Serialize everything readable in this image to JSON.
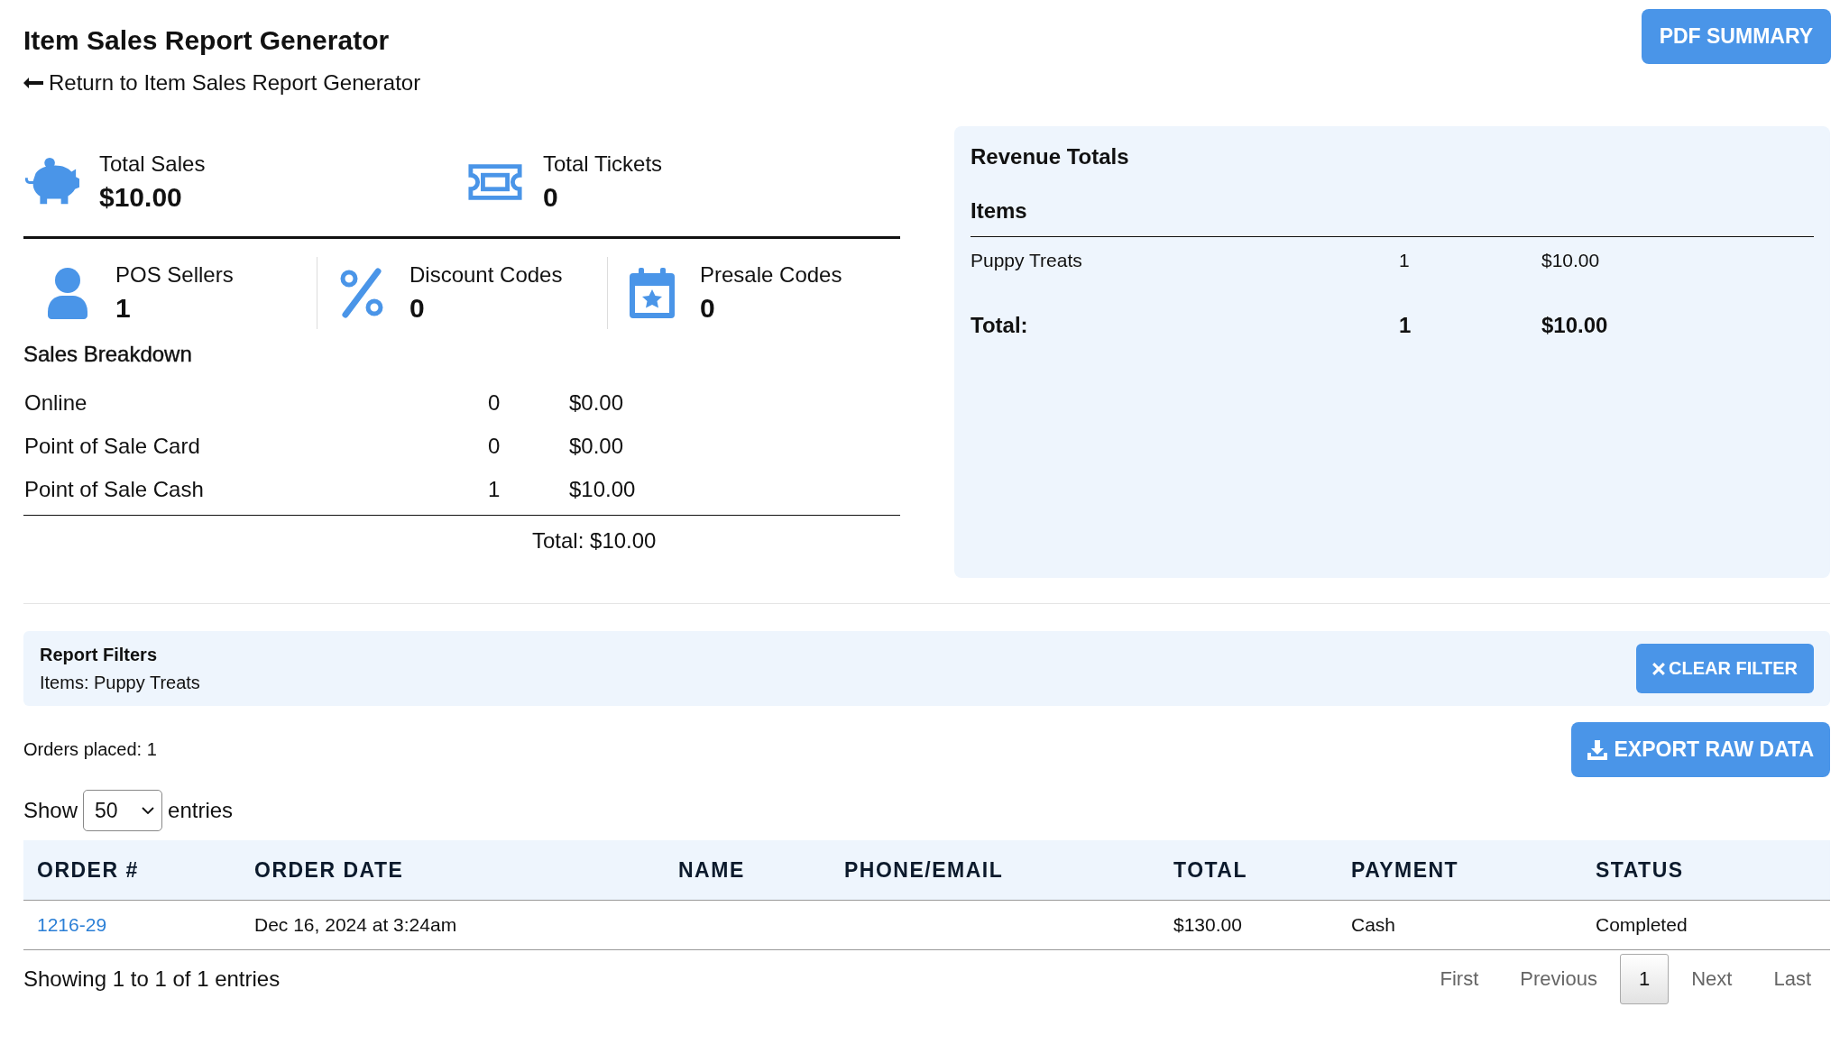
{
  "header": {
    "title": "Item Sales Report Generator",
    "back_link": "Return to Item Sales Report Generator",
    "pdf_button": "PDF SUMMARY"
  },
  "stats_top": [
    {
      "kind": "piggy",
      "label": "Total Sales",
      "value": "$10.00"
    },
    {
      "kind": "ticket",
      "label": "Total Tickets",
      "value": "0"
    }
  ],
  "stats_bottom": [
    {
      "kind": "person",
      "label": "POS Sellers",
      "value": "1"
    },
    {
      "kind": "percent",
      "label": "Discount Codes",
      "value": "0"
    },
    {
      "kind": "calendar",
      "label": "Presale Codes",
      "value": "0"
    }
  ],
  "sales_breakdown": {
    "title": "Sales Breakdown",
    "rows": [
      {
        "channel": "Online",
        "count": "0",
        "amount": "$0.00"
      },
      {
        "channel": "Point of Sale Card",
        "count": "0",
        "amount": "$0.00"
      },
      {
        "channel": "Point of Sale Cash",
        "count": "1",
        "amount": "$10.00"
      }
    ],
    "total": "Total: $10.00"
  },
  "revenue_totals": {
    "title": "Revenue Totals",
    "subtitle": "Items",
    "rows": [
      {
        "name": "Puppy Treats",
        "count": "1",
        "amount": "$10.00"
      }
    ],
    "total": {
      "label": "Total:",
      "count": "1",
      "amount": "$10.00"
    }
  },
  "report_filters": {
    "title": "Report Filters",
    "text": "Items: Puppy Treats",
    "clear_button": "CLEAR FILTER"
  },
  "orders_placed": "Orders placed: 1",
  "export_button": "EXPORT RAW DATA",
  "entries": {
    "prefix": "Show",
    "value": "50",
    "suffix": "entries"
  },
  "table": {
    "columns": [
      "ORDER #",
      "ORDER DATE",
      "NAME",
      "PHONE/EMAIL",
      "TOTAL",
      "PAYMENT",
      "STATUS"
    ],
    "rows": [
      {
        "cells": [
          "1216-29",
          "Dec 16, 2024 at 3:24am",
          "",
          "",
          "$130.00",
          "Cash",
          "Completed"
        ]
      }
    ]
  },
  "table_info": "Showing 1 to 1 of 1 entries",
  "pagination": [
    {
      "label": "First",
      "selected": false
    },
    {
      "label": "Previous",
      "selected": false
    },
    {
      "label": "1",
      "selected": true
    },
    {
      "label": "Next",
      "selected": false
    },
    {
      "label": "Last",
      "selected": false
    }
  ]
}
